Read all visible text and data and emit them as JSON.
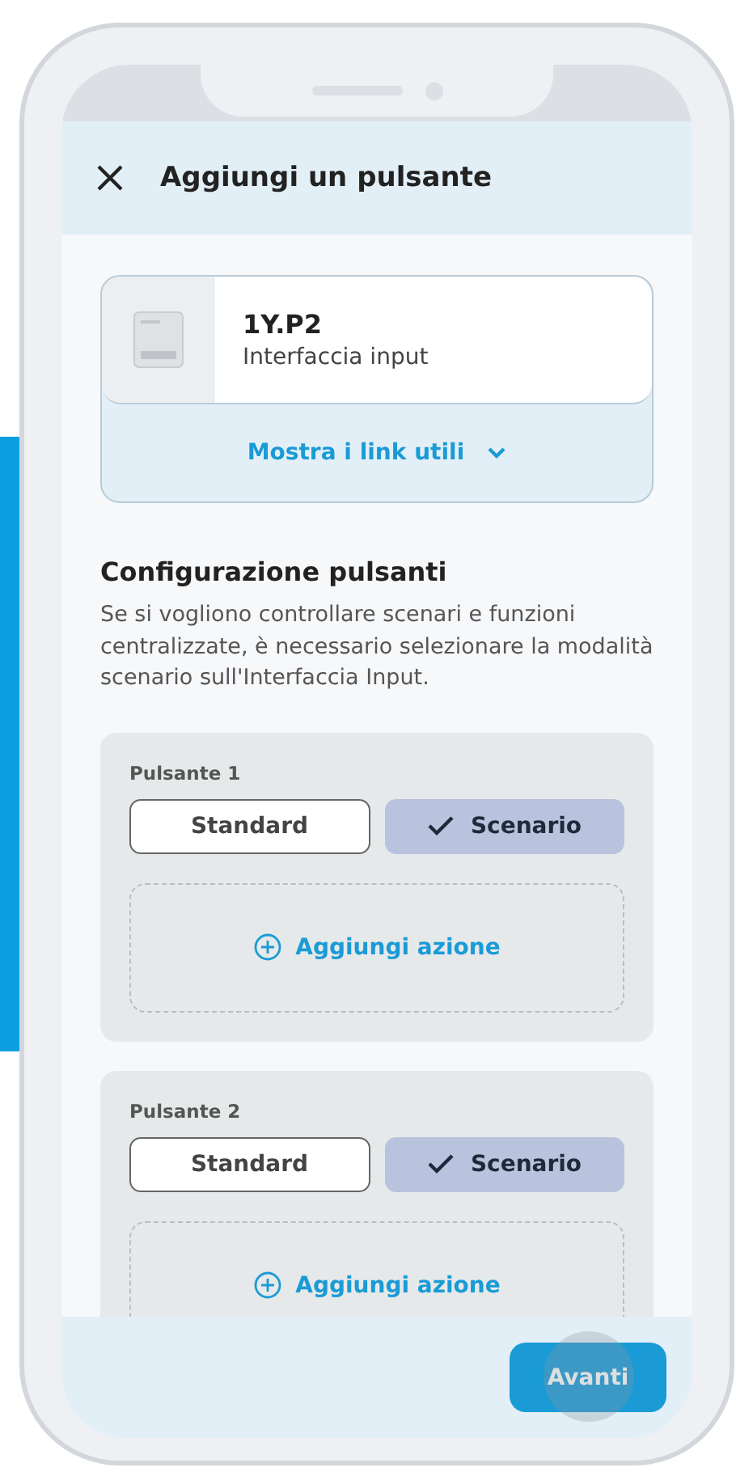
{
  "header": {
    "title": "Aggiungi un pulsante"
  },
  "device": {
    "name": "1Y.P2",
    "type": "Interfaccia input",
    "link": "Mostra i link utili"
  },
  "section": {
    "title": "Configurazione pulsanti",
    "description": "Se si vogliono controllare scenari e funzioni centralizzate, è necessario selezionare la modalità scenario sull'Interfaccia Input."
  },
  "buttons": [
    {
      "label": "Pulsante 1",
      "modes": [
        {
          "label": "Standard",
          "selected": false
        },
        {
          "label": "Scenario",
          "selected": true
        }
      ],
      "add_action": "Aggiungi azione"
    },
    {
      "label": "Pulsante 2",
      "modes": [
        {
          "label": "Standard",
          "selected": false
        },
        {
          "label": "Scenario",
          "selected": true
        }
      ],
      "add_action": "Aggiungi azione"
    }
  ],
  "footer": {
    "next": "Avanti"
  }
}
